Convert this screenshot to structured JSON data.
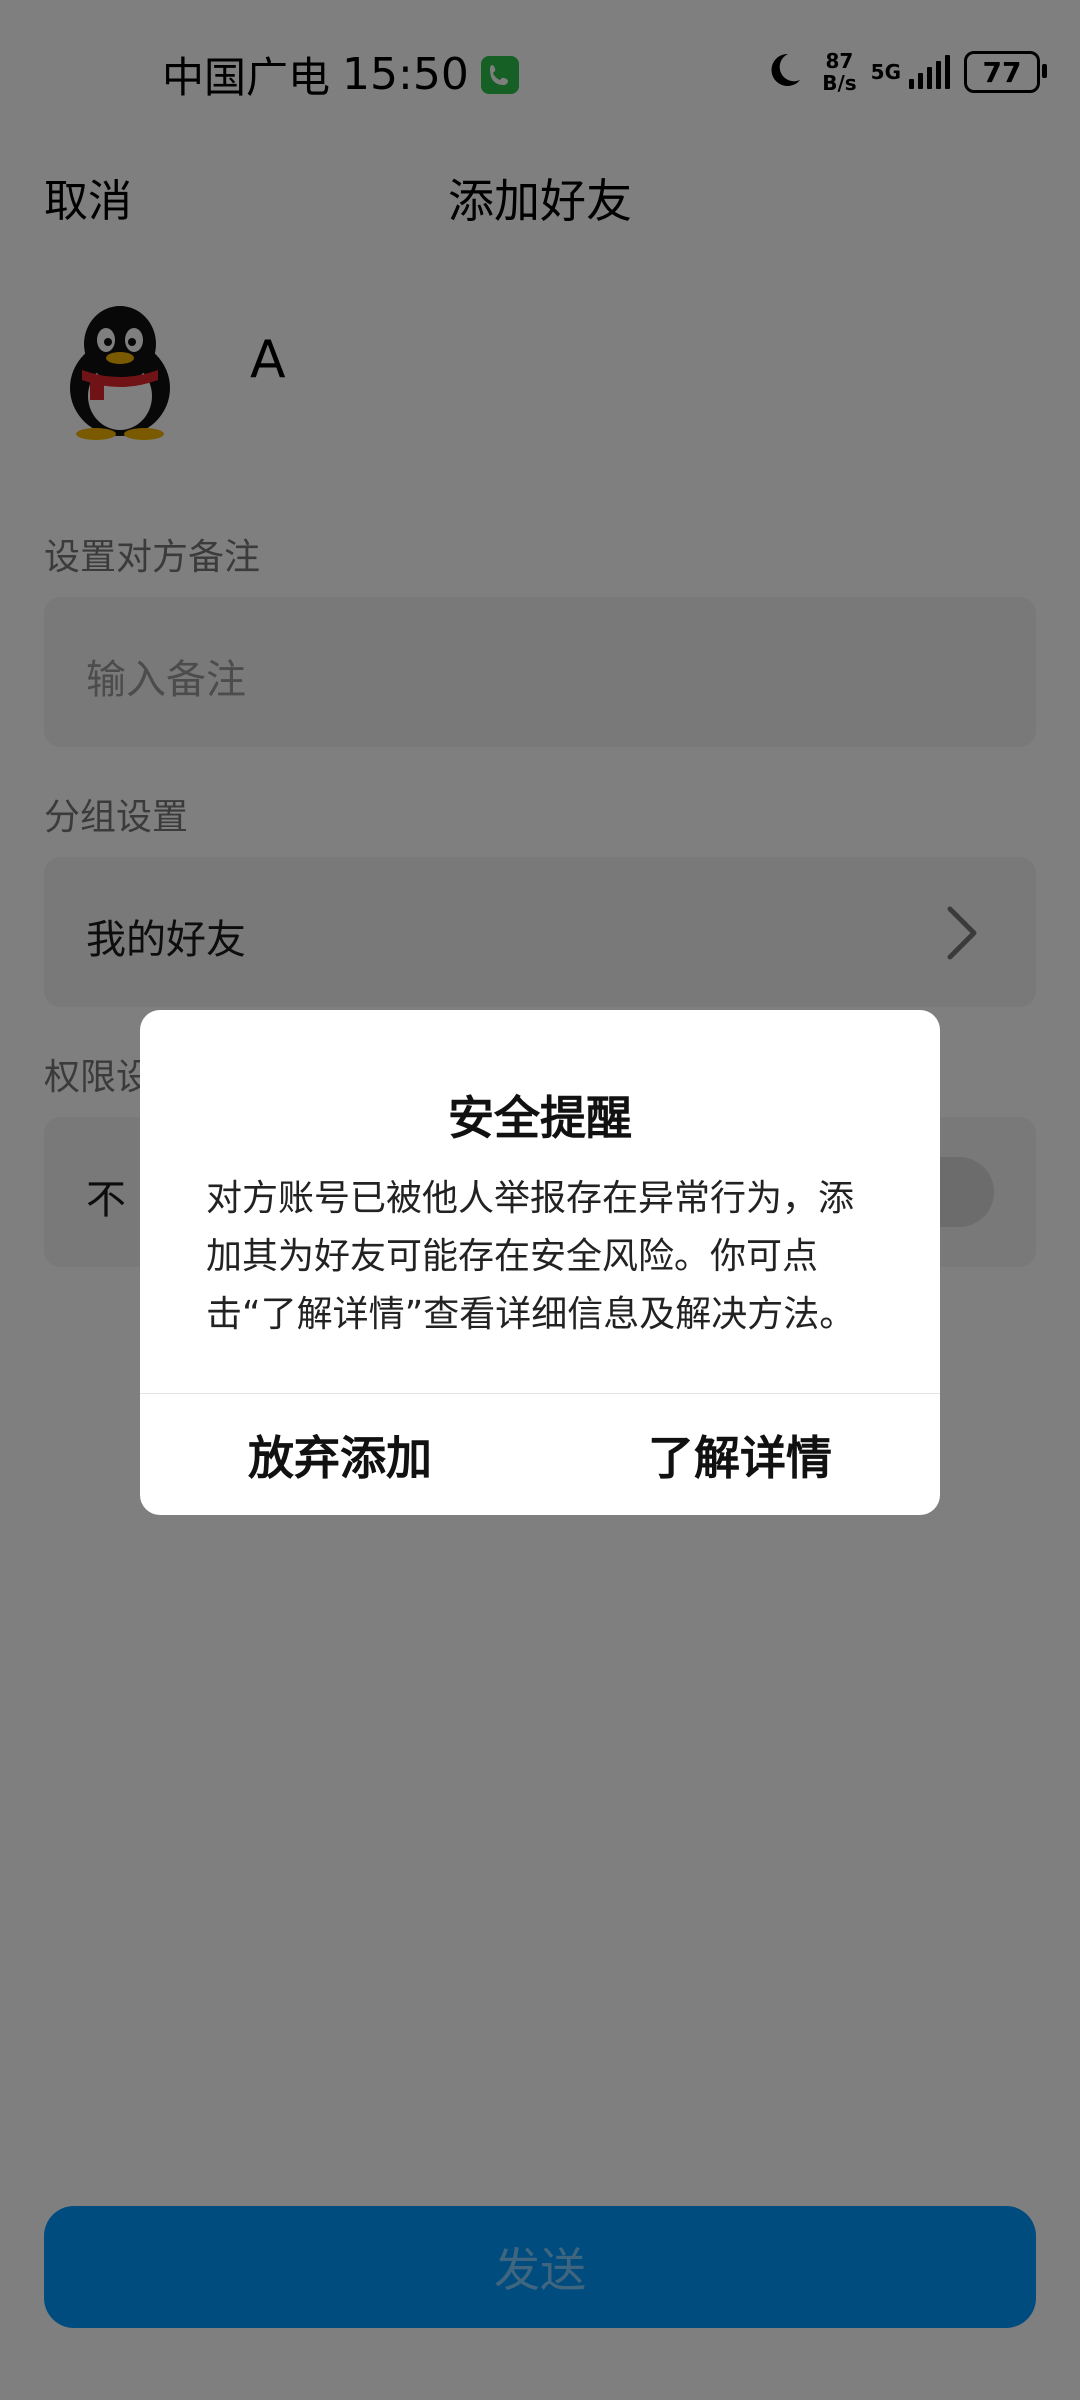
{
  "status_bar": {
    "carrier": "中国广电",
    "time": "15:50",
    "net_speed_top": "87",
    "net_speed_bottom": "B/s",
    "network": "5G",
    "battery": "77"
  },
  "nav": {
    "cancel_label": "取消",
    "title": "添加好友"
  },
  "profile": {
    "name": "A",
    "avatar_icon": "qq-penguin-icon"
  },
  "remark": {
    "section_label": "设置对方备注",
    "placeholder": "输入备注"
  },
  "group": {
    "section_label": "分组设置",
    "value": "我的好友"
  },
  "permission": {
    "section_label": "权限设",
    "row_label": "不"
  },
  "send_button": {
    "label": "发送"
  },
  "dialog": {
    "title": "安全提醒",
    "body": "对方账号已被他人举报存在异常行为，添加其为好友可能存在安全风险。你可点击“了解详情”查看详细信息及解决方法。",
    "abandon_label": "放弃添加",
    "details_label": "了解详情"
  },
  "colors": {
    "accent": "#0099ff",
    "overlay": "rgba(0,0,0,0.5)"
  }
}
